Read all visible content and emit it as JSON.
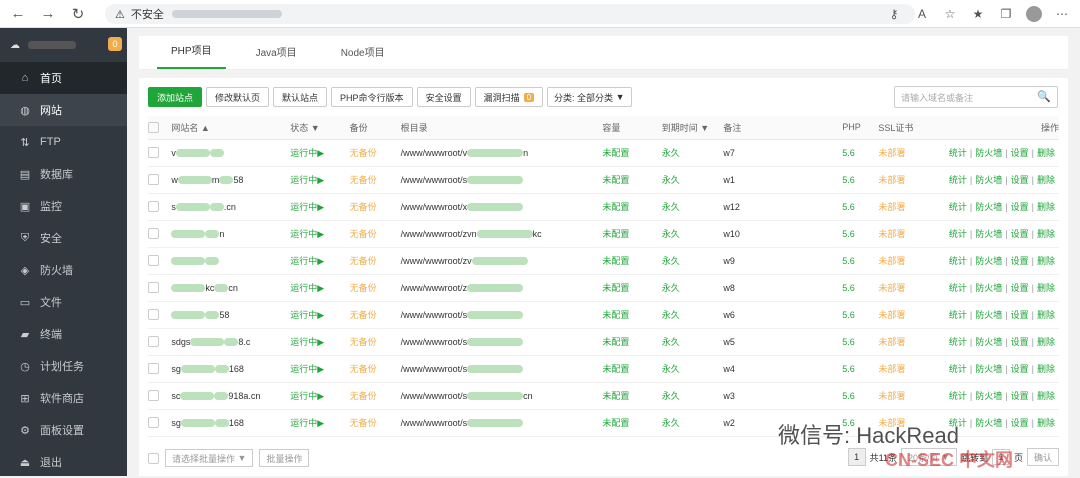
{
  "browser": {
    "security_label": "不安全",
    "ip_hidden": "·"
  },
  "sidebar": {
    "badge": "0",
    "items": [
      {
        "label": "首页",
        "icon": "home-icon"
      },
      {
        "label": "网站",
        "icon": "globe-icon"
      },
      {
        "label": "FTP",
        "icon": "ftp-icon"
      },
      {
        "label": "数据库",
        "icon": "database-icon"
      },
      {
        "label": "监控",
        "icon": "monitor-icon"
      },
      {
        "label": "安全",
        "icon": "shield-icon"
      },
      {
        "label": "防火墙",
        "icon": "firewall-icon"
      },
      {
        "label": "文件",
        "icon": "folder-icon"
      },
      {
        "label": "终端",
        "icon": "terminal-icon"
      },
      {
        "label": "计划任务",
        "icon": "clock-icon"
      },
      {
        "label": "软件商店",
        "icon": "store-icon"
      },
      {
        "label": "面板设置",
        "icon": "settings-icon"
      },
      {
        "label": "退出",
        "icon": "logout-icon"
      }
    ]
  },
  "tabs": [
    "PHP项目",
    "Java项目",
    "Node项目"
  ],
  "toolbar": {
    "add": "添加站点",
    "default_page": "修改默认页",
    "default_site": "默认站点",
    "php_cli": "PHP命令行版本",
    "security": "安全设置",
    "scan": "漏洞扫描",
    "scan_count": "0",
    "category": "分类: 全部分类",
    "search_placeholder": "请输入域名或备注"
  },
  "table": {
    "headers": [
      "网站名 ▲",
      "状态 ▼",
      "备份",
      "根目录",
      "容量",
      "到期时间 ▼",
      "备注",
      "PHP",
      "SSL证书",
      "操作"
    ],
    "rows": [
      {
        "name": "v",
        "status": "运行中▶",
        "backup": "无备份",
        "root": "/www/wwwroot/v",
        "root_tail": "n",
        "quota": "未配置",
        "expire": "永久",
        "note": "w7",
        "php": "5.6",
        "ssl": "未部署"
      },
      {
        "name": "w",
        "name_mid": "m",
        "name_tail": "58",
        "status": "运行中▶",
        "backup": "无备份",
        "root": "/www/wwwroot/s",
        "root_tail": "",
        "quota": "未配置",
        "expire": "永久",
        "note": "w1",
        "php": "5.6",
        "ssl": "未部署"
      },
      {
        "name": "s",
        "name_tail": ".cn",
        "status": "运行中▶",
        "backup": "无备份",
        "root": "/www/wwwroot/x",
        "root_tail": "",
        "quota": "未配置",
        "expire": "永久",
        "note": "w12",
        "php": "5.6",
        "ssl": "未部署"
      },
      {
        "name": "",
        "name_tail": "n",
        "status": "运行中▶",
        "backup": "无备份",
        "root": "/www/wwwroot/zvn",
        "root_tail": "kc",
        "quota": "未配置",
        "expire": "永久",
        "note": "w10",
        "php": "5.6",
        "ssl": "未部署"
      },
      {
        "name": "",
        "status": "运行中▶",
        "backup": "无备份",
        "root": "/www/wwwroot/zv",
        "root_tail": "",
        "quota": "未配置",
        "expire": "永久",
        "note": "w9",
        "php": "5.6",
        "ssl": "未部署"
      },
      {
        "name": "",
        "name_mid": "kc",
        "name_tail": "cn",
        "status": "运行中▶",
        "backup": "无备份",
        "root": "/www/wwwroot/z",
        "root_tail": "",
        "quota": "未配置",
        "expire": "永久",
        "note": "w8",
        "php": "5.6",
        "ssl": "未部署"
      },
      {
        "name": "",
        "name_tail": "58",
        "status": "运行中▶",
        "backup": "无备份",
        "root": "/www/wwwroot/s",
        "root_tail": "",
        "quota": "未配置",
        "expire": "永久",
        "note": "w6",
        "php": "5.6",
        "ssl": "未部署"
      },
      {
        "name": "sdgs",
        "name_tail": "8.c",
        "status": "运行中▶",
        "backup": "无备份",
        "root": "/www/wwwroot/s",
        "root_tail": "",
        "quota": "未配置",
        "expire": "永久",
        "note": "w5",
        "php": "5.6",
        "ssl": "未部署"
      },
      {
        "name": "sg",
        "name_tail": "168",
        "status": "运行中▶",
        "backup": "无备份",
        "root": "/www/wwwroot/s",
        "root_tail": "",
        "quota": "未配置",
        "expire": "永久",
        "note": "w4",
        "php": "5.6",
        "ssl": "未部署"
      },
      {
        "name": "sc",
        "name_tail": "918a.cn",
        "status": "运行中▶",
        "backup": "无备份",
        "root": "/www/wwwroot/s",
        "root_tail": "cn",
        "quota": "未配置",
        "expire": "永久",
        "note": "w3",
        "php": "5.6",
        "ssl": "未部署"
      },
      {
        "name": "sg",
        "name_tail": "168",
        "status": "运行中▶",
        "backup": "无备份",
        "root": "/www/wwwroot/s",
        "root_tail": "",
        "quota": "未配置",
        "expire": "永久",
        "note": "w2",
        "php": "5.6",
        "ssl": "未部署"
      }
    ],
    "ops": [
      "统计",
      "防火墙",
      "设置",
      "删除"
    ]
  },
  "footer": {
    "batch_select": "请选择批量操作",
    "batch_btn": "批量操作",
    "page": "1",
    "total": "共11条",
    "per_page": "20条/页",
    "jump": "跳转到",
    "page_input": "1",
    "page_unit": "页",
    "confirm": "确认"
  },
  "watermark": {
    "text": "微信号: HackRead",
    "text2": "CN-SEC 中文网"
  }
}
